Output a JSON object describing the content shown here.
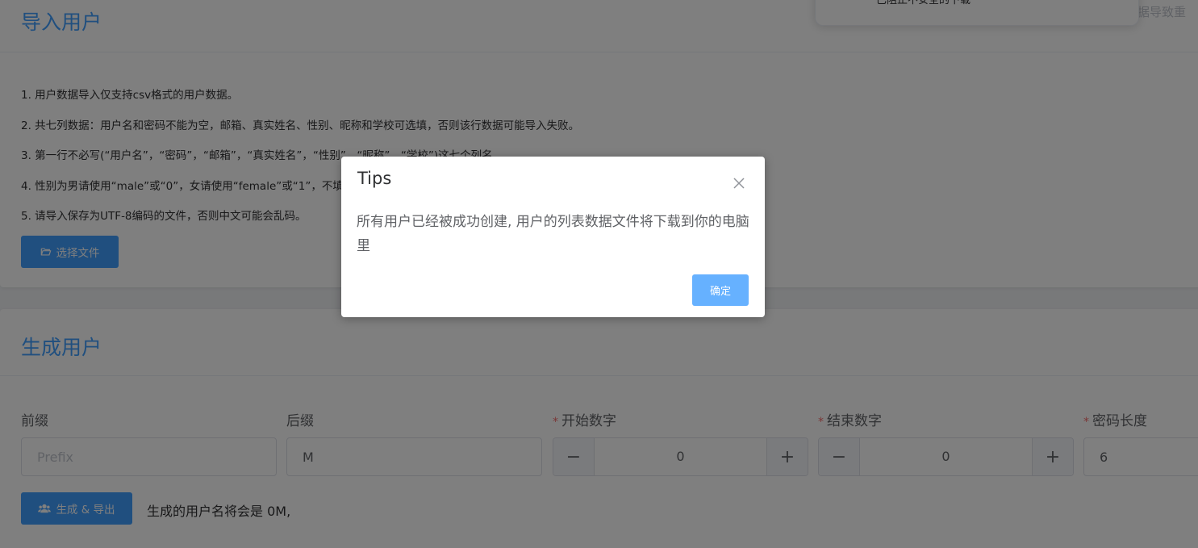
{
  "import_section": {
    "title": "导入用户",
    "header_right_text": "据导致重",
    "instructions": [
      "1. 用户数据导入仅支持csv格式的用户数据。",
      "2. 共七列数据：用户名和密码不能为空，邮箱、真实姓名、性别、昵称和学校可选填，否则该行数据可能导入失败。",
      "3. 第一行不必写(“用户名”，“密码”，“邮箱”，“真实姓名”，“性别”，“昵称”，“学校”)这七个列名",
      "4. 性别为男请使用“male”或“0”，女请使用“female”或“1”，不填",
      "5. 请导入保存为UTF-8编码的文件，否则中文可能会乱码。"
    ],
    "choose_file_label": "选择文件"
  },
  "generate_section": {
    "title": "生成用户",
    "prefix": {
      "label": "前缀",
      "placeholder": "Prefix",
      "value": ""
    },
    "suffix": {
      "label": "后缀",
      "value": "M"
    },
    "start_number": {
      "label": "开始数字",
      "value": "0",
      "minus": "−",
      "plus": "+"
    },
    "end_number": {
      "label": "结束数字",
      "value": "0",
      "minus": "−",
      "plus": "+"
    },
    "password_length": {
      "label": "密码长度",
      "value": "6"
    },
    "required_mark": "*",
    "generate_label": "生成 & 导出",
    "hint": "生成的用户名将会是 0M,"
  },
  "notification": {
    "text": "已阻止不安全的下载"
  },
  "dialog": {
    "title": "Tips",
    "message": "所有用户已经被成功创建, 用户的列表数据文件将下载到你的电脑里",
    "confirm_label": "确定"
  },
  "colors": {
    "primary": "#409eff",
    "primary_light": "#66b1ff",
    "required": "#f56c6c",
    "overlay": "rgba(0,0,0,0.5)"
  }
}
